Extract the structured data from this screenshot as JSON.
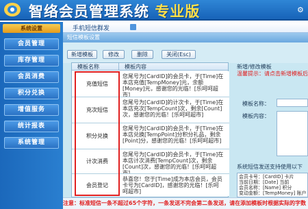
{
  "app": {
    "title": "智络会员管理系统",
    "edition": "专业版"
  },
  "sidebar": {
    "top_label": "系统设置",
    "items": [
      {
        "label": "会员管理"
      },
      {
        "label": "库存管理"
      },
      {
        "label": "会员消费"
      },
      {
        "label": "积分兑换"
      },
      {
        "label": "增值服务"
      },
      {
        "label": "统计报表"
      },
      {
        "label": "系统管理"
      }
    ]
  },
  "tab": {
    "title": "手机短信群发"
  },
  "panel": {
    "header": "短信模板设置",
    "toolbar": {
      "new": "新增模板",
      "edit": "修改",
      "delete": "删除",
      "close": "关闭(Esc)"
    },
    "table": {
      "columns": [
        "模板名称",
        "模板内容"
      ],
      "rows": [
        {
          "name": "充值短信",
          "content": "您尾号为[CardID]的会员卡，于[Time]在本店充值[TempMoney]元，余额[Money]元，感谢您的光临！[乐呵呵超市]"
        },
        {
          "name": "充次短信",
          "content": "您尾号为[CardID]的计次卡，于[Time]在本店充次[TempCount]次，剩余[Count]次，感谢您的光临！[乐呵呵超市]"
        },
        {
          "name": "积分兑换",
          "content": "您尾号为[CardID]的会员卡，于[Time]在本店兑换[TempPoint]分积分礼品，剩余[Point]分，感谢您的光临！[乐呵呵超市]"
        },
        {
          "name": "计次消费",
          "content": "您尾号为[CardID]的会员卡，于[Time]在本店计次消费[TempCount]次，剩余[Count]次，感谢您的光临！[乐呵呵超市]"
        },
        {
          "name": "会员登记",
          "content": "恭喜您！您于[Time]成为本店会员，会员卡号为[CardID]，感谢您的光临！[乐呵呵超市]"
        }
      ]
    }
  },
  "editor": {
    "title": "新增/修改模板",
    "hint": "温馨提示：请点击新增模板后",
    "name_label": "模板名称：",
    "content_label": "模板内容：",
    "note": "系统短信发送支持使用以下",
    "vars": [
      "会员卡号：[CardID]  卡片",
      "当前日期：[Date]   当前",
      "会员名称：[Name]   积分",
      "变动金额：[TempMoney] 账户",
      "变动积分：[TempPoint] 账户",
      "变动次数：[TempCount]"
    ]
  },
  "footer": "注意：标准短信一条不超过65个字符，一条发送不完会第二条发送，请在添加模板时根据实际的字数"
}
